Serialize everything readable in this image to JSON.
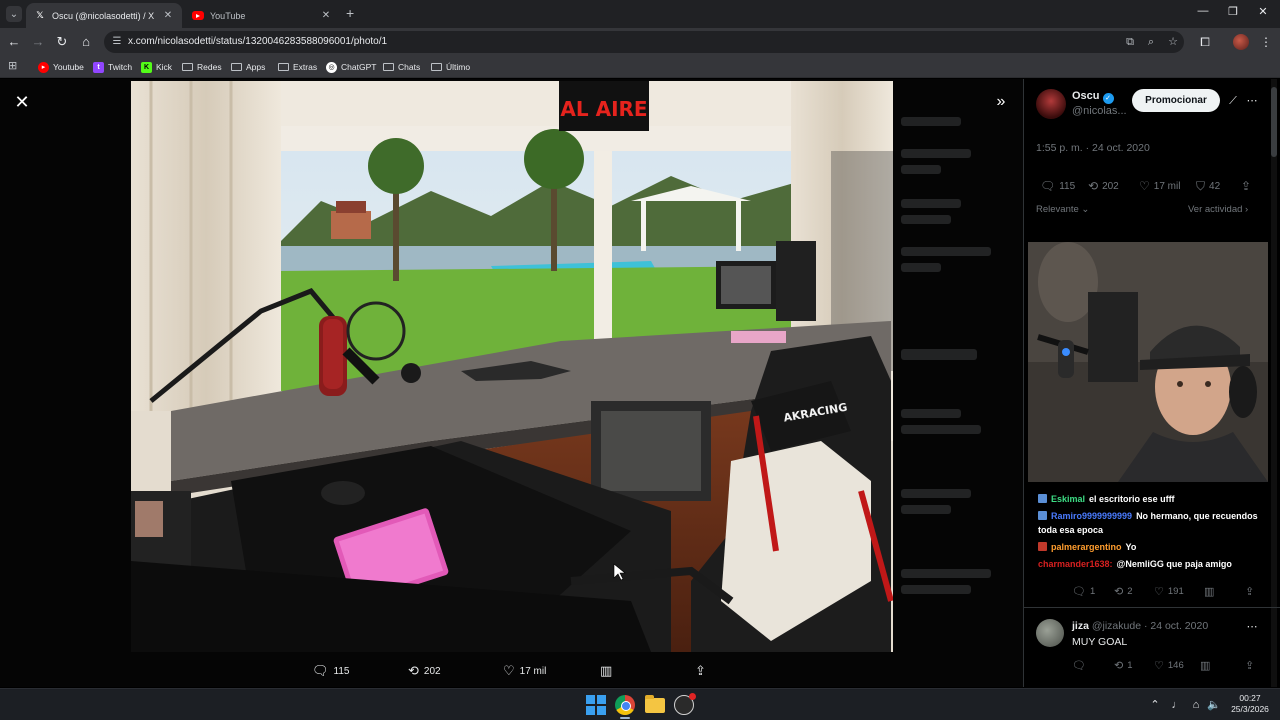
{
  "browser": {
    "tabs": [
      {
        "title": "Oscu (@nicolasodetti) / X",
        "active": true,
        "favicon": "x-icon"
      },
      {
        "title": "YouTube",
        "active": false,
        "favicon": "youtube-icon"
      }
    ],
    "url": "x.com/nicolasodetti/status/1320046283588096001/photo/1",
    "bookmarks": [
      {
        "label": "Youtube",
        "icon": "youtube-icon",
        "color": "#ff0000"
      },
      {
        "label": "Twitch",
        "icon": "twitch-icon",
        "color": "#9146ff"
      },
      {
        "label": "Kick",
        "icon": "kick-icon",
        "color": "#53fc18"
      },
      {
        "label": "Redes",
        "icon": "folder-icon"
      },
      {
        "label": "Apps",
        "icon": "folder-icon"
      },
      {
        "label": "Extras",
        "icon": "folder-icon"
      },
      {
        "label": "ChatGPT",
        "icon": "chatgpt-icon"
      },
      {
        "label": "Chats",
        "icon": "folder-icon"
      },
      {
        "label": "Último",
        "icon": "folder-icon"
      }
    ]
  },
  "media": {
    "photo_sign": "AL AIRE",
    "chair_brand": "AKRACING",
    "actions": {
      "replies": "115",
      "reposts": "202",
      "likes": "17 mil"
    }
  },
  "post": {
    "author_name": "Oscu",
    "author_handle": "@nicolas...",
    "promote_label": "Promocionar",
    "timestamp": "1:55 p. m. · 24 oct. 2020",
    "stats": {
      "replies": "115",
      "reposts": "202",
      "likes": "17 mil",
      "bookmarks": "42"
    },
    "sort_label": "Relevante",
    "activity_label": "Ver actividad"
  },
  "chat": [
    {
      "user": "Eskimal",
      "user_color": "#3ddc84",
      "badge_color": "#5b8fd6",
      "message": "el escritorio ese ufff"
    },
    {
      "user": "Ramiro9999999999",
      "user_color": "#4a7bff",
      "badge_color": "#5b8fd6",
      "message": "No hermano, que recuendos toda esa epoca"
    },
    {
      "user": "palmerargentino",
      "user_color": "#ff9d2e",
      "badge_color": "#c0392b",
      "message": "Yo"
    },
    {
      "user": "charmander1638:",
      "user_color": "#d62020",
      "badge_color": "",
      "message": "@NemliGG que paja amigo"
    }
  ],
  "reply_actions": {
    "replies": "1",
    "reposts": "2",
    "likes": "191"
  },
  "reply2": {
    "name": "jiza",
    "meta": "@jizakude · 24 oct. 2020",
    "text": "MUY GOAL",
    "replies": "",
    "reposts": "1",
    "likes": "146"
  },
  "taskbar": {
    "time": "00:27",
    "date": "25/3/2026"
  },
  "colors": {
    "x_blue": "#1d9bf0",
    "bg": "#000000",
    "muted_text": "#71767b"
  }
}
